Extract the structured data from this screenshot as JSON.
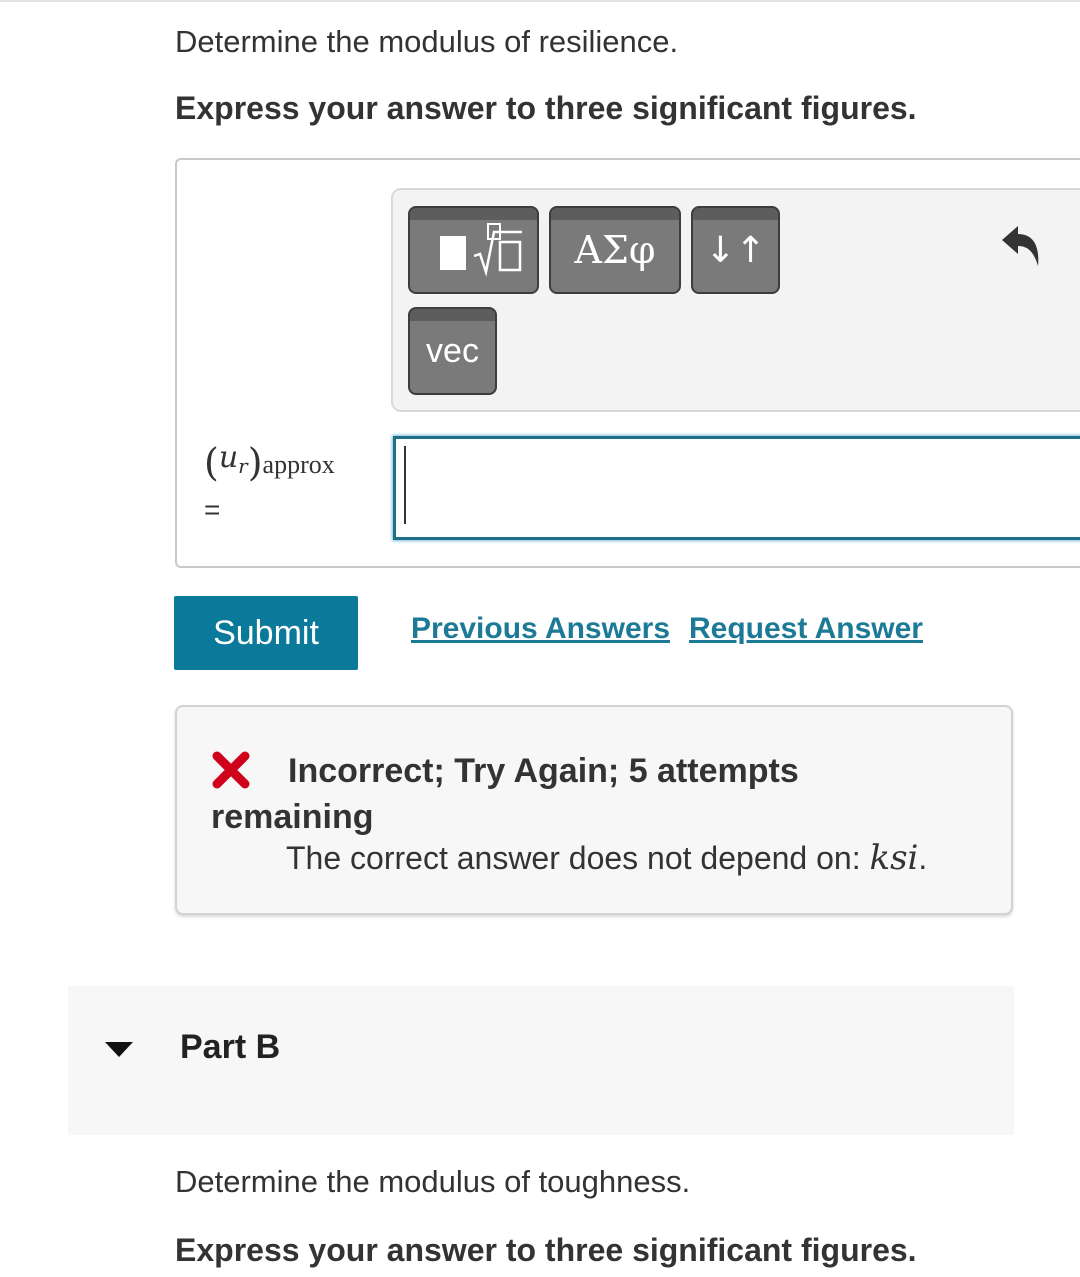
{
  "part_a": {
    "question": "Determine the modulus of resilience.",
    "instruction": "Express your answer to three significant figures."
  },
  "toolbar": {
    "templates_icon": "fraction-sqrt-template-icon",
    "greek_label": "ΑΣφ",
    "arrows_label": "↓↑",
    "vec_label": "vec",
    "undo_icon": "undo-icon"
  },
  "answer": {
    "variable_symbol": "u",
    "variable_subscript": "r",
    "variable_qualifier": "approx",
    "equals": "=",
    "value": ""
  },
  "actions": {
    "submit_label": "Submit",
    "previous_answers_label": "Previous Answers",
    "request_answer_label": "Request Answer"
  },
  "feedback": {
    "status_icon": "x-icon",
    "title": "Incorrect; Try Again; 5 attempts remaining",
    "detail_prefix": "The correct answer does not depend on: ",
    "detail_math": "ksi",
    "detail_suffix": ".",
    "colors": {
      "error": "#d0021b"
    }
  },
  "part_b": {
    "title": "Part B",
    "question": "Determine the modulus of toughness.",
    "instruction": "Express your answer to three significant figures."
  },
  "colors": {
    "accent": "#0b7a9a",
    "link": "#1d7a97",
    "input_border": "#1f6f8b"
  }
}
